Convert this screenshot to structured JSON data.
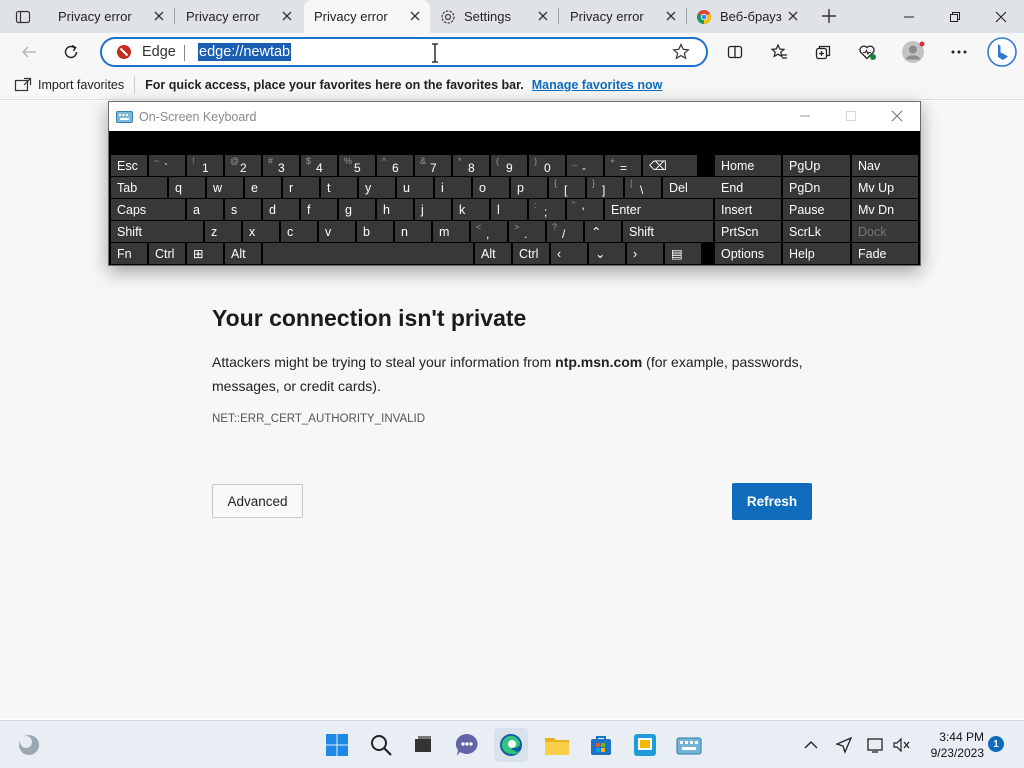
{
  "tabs": [
    {
      "title": "Privacy error",
      "active": false
    },
    {
      "title": "Privacy error",
      "active": false
    },
    {
      "title": "Privacy error",
      "active": true
    },
    {
      "title": "Settings",
      "active": false
    },
    {
      "title": "Privacy error",
      "active": false
    },
    {
      "title": "Веб-браузер",
      "active": false
    }
  ],
  "address": {
    "site_label": "Edge",
    "url": "edge://newtab"
  },
  "favorites_bar": {
    "import_label": "Import favorites",
    "hint": "For quick access, place your favorites here on the favorites bar.",
    "manage_link": "Manage favorites now"
  },
  "osk": {
    "title": "On-Screen Keyboard",
    "rows": [
      [
        {
          "m": "Esc"
        },
        {
          "s": "~",
          "m": "`"
        },
        {
          "s": "!",
          "m": "1"
        },
        {
          "s": "@",
          "m": "2"
        },
        {
          "s": "#",
          "m": "3"
        },
        {
          "s": "$",
          "m": "4"
        },
        {
          "s": "%",
          "m": "5"
        },
        {
          "s": "^",
          "m": "6"
        },
        {
          "s": "&",
          "m": "7"
        },
        {
          "s": "*",
          "m": "8"
        },
        {
          "s": "(",
          "m": "9"
        },
        {
          "s": ")",
          "m": "0"
        },
        {
          "s": "_",
          "m": "-"
        },
        {
          "s": "+",
          "m": "="
        },
        {
          "m": "⌫"
        }
      ],
      [
        {
          "m": "Tab"
        },
        {
          "m": "q"
        },
        {
          "m": "w"
        },
        {
          "m": "e"
        },
        {
          "m": "r"
        },
        {
          "m": "t"
        },
        {
          "m": "y"
        },
        {
          "m": "u"
        },
        {
          "m": "i"
        },
        {
          "m": "o"
        },
        {
          "m": "p"
        },
        {
          "s": "{",
          "m": "["
        },
        {
          "s": "}",
          "m": "]"
        },
        {
          "s": "|",
          "m": "\\"
        },
        {
          "m": "Del"
        }
      ],
      [
        {
          "m": "Caps"
        },
        {
          "m": "a"
        },
        {
          "m": "s"
        },
        {
          "m": "d"
        },
        {
          "m": "f"
        },
        {
          "m": "g"
        },
        {
          "m": "h"
        },
        {
          "m": "j"
        },
        {
          "m": "k"
        },
        {
          "m": "l"
        },
        {
          "s": ":",
          "m": ";"
        },
        {
          "s": "\"",
          "m": "'"
        },
        {
          "m": "Enter"
        }
      ],
      [
        {
          "m": "Shift"
        },
        {
          "m": "z"
        },
        {
          "m": "x"
        },
        {
          "m": "c"
        },
        {
          "m": "v"
        },
        {
          "m": "b"
        },
        {
          "m": "n"
        },
        {
          "m": "m"
        },
        {
          "s": "<",
          "m": ","
        },
        {
          "s": ">",
          "m": "."
        },
        {
          "s": "?",
          "m": "/"
        },
        {
          "m": "⌃"
        },
        {
          "m": "Shift"
        }
      ],
      [
        {
          "m": "Fn"
        },
        {
          "m": "Ctrl"
        },
        {
          "m": "⊞"
        },
        {
          "m": "Alt"
        },
        {
          "m": ""
        },
        {
          "m": "Alt"
        },
        {
          "m": "Ctrl"
        },
        {
          "m": "‹"
        },
        {
          "m": "⌄"
        },
        {
          "m": "›"
        },
        {
          "m": "▤"
        }
      ]
    ],
    "nav_keys": [
      [
        "Home",
        "PgUp",
        "Nav"
      ],
      [
        "End",
        "PgDn",
        "Mv Up"
      ],
      [
        "Insert",
        "Pause",
        "Mv Dn"
      ],
      [
        "PrtScn",
        "ScrLk",
        "Dock"
      ],
      [
        "Options",
        "Help",
        "Fade"
      ]
    ]
  },
  "error": {
    "title": "Your connection isn't private",
    "desc_before": "Attackers might be trying to steal your information from ",
    "host": "ntp.msn.com",
    "desc_after": " (for example, passwords, messages, or credit cards).",
    "code": "NET::ERR_CERT_AUTHORITY_INVALID",
    "advanced_label": "Advanced",
    "refresh_label": "Refresh"
  },
  "taskbar": {
    "time": "3:44 PM",
    "date": "9/23/2023",
    "badge": "1"
  },
  "colors": {
    "accent": "#0f6cbd",
    "address_border": "#1a73c8",
    "osk_key": "#383838"
  }
}
